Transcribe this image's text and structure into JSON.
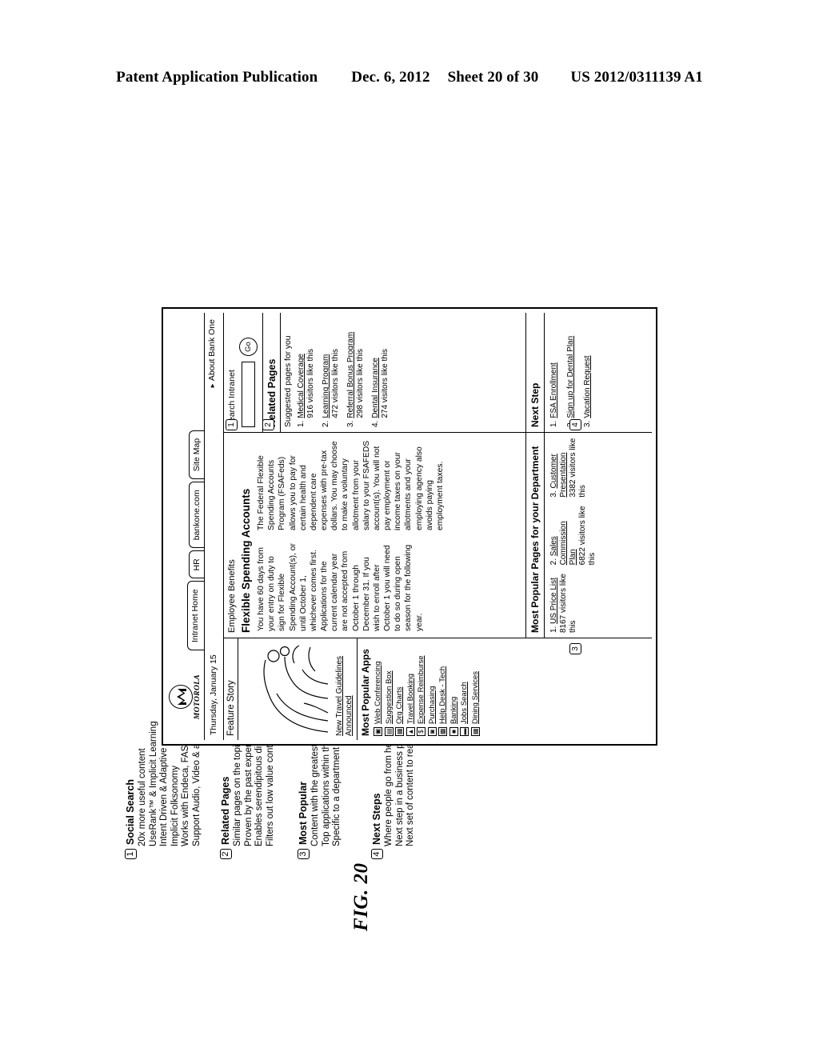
{
  "patent_header": {
    "publication": "Patent Application Publication",
    "date": "Dec. 6, 2012",
    "sheet": "Sheet 20 of 30",
    "number": "US 2012/0311139 A1"
  },
  "figure": {
    "caption": "FIG. 20"
  },
  "callouts": [
    {
      "num": "1",
      "title": "Social Search",
      "bullets": [
        "20x more useful content",
        "UseRank™ & Implicit Learning",
        "Intent Driven & Adaptive",
        "Implicit Folksonomy",
        "Works with Endeca, FAST, any engine",
        "Support Audio, Video & all Content Types"
      ]
    },
    {
      "num": "2",
      "title": "Related Pages",
      "bullets": [
        "Similar pages on the topic",
        "Proven by the past experience of peers",
        "Enables serendipitous discovery",
        "Filters out low value content"
      ]
    },
    {
      "num": "3",
      "title": "Most Popular",
      "bullets": [
        "Content with the greatest value",
        "Top applications within the company",
        "Specific to a department or cross company"
      ]
    },
    {
      "num": "4",
      "title": "Next Steps",
      "bullets": [
        "Where people go from here to meet goals",
        "Next step in a business process",
        "Next set of content to read"
      ]
    }
  ],
  "browser": {
    "logo_word": "MOTOROLA",
    "tabs": [
      {
        "label": "Intranet Home",
        "active": true
      },
      {
        "label": "HR",
        "active": false
      },
      {
        "label": "bankone.com",
        "active": false
      },
      {
        "label": "Site Map",
        "active": false
      }
    ],
    "date": "Thursday, January 15",
    "about_link": "About Bank One",
    "left_column": {
      "feature_story_title": "Feature Story",
      "travel_link": "New Travel Guidelines Announced",
      "apps_heading": "Most Popular Apps",
      "apps": [
        {
          "label": "Web Conferencing",
          "icon": "webcam-icon"
        },
        {
          "label": "Suggestion Box",
          "icon": "inbox-icon"
        },
        {
          "label": "Org Charts",
          "icon": "org-chart-icon"
        },
        {
          "label": "Travel Booking",
          "icon": "plane-icon"
        },
        {
          "label": "Expense Reimburse",
          "icon": "dollar-icon"
        },
        {
          "label": "Purchasing",
          "icon": "cart-icon"
        },
        {
          "label": "Help Desk - Tech",
          "icon": "wrench-icon"
        },
        {
          "label": "Banking",
          "icon": "bank-icon"
        },
        {
          "label": "Jobs Search",
          "icon": "briefcase-icon"
        },
        {
          "label": "Dining Services",
          "icon": "cutlery-icon"
        }
      ]
    },
    "center_column": {
      "breadcrumb": "Employee Benefits",
      "page_title": "Flexible Spending Accounts",
      "paragraph_1": "You have 60 days from your entry on duty to sign for Flexible Spending Account(s), or until October 1, whichever comes first. Applications for the current calendar year are not accepted from October 1 through December 31. If you wish to enroll after October 1 you will need to do so during open season for the following year.",
      "paragraph_2": "The Federal Flexible Spending Accounts Program (FSAFeds) allows you to pay for certain health and dependent care expenses with pre-tax dollars. You may choose to make a voluntary allotment from your salary to your FSAFEDS account(s). You will not pay employment or income taxes on your allotments and your employing agency also avoids paying employment taxes.",
      "most_popular_heading": "Most Popular Pages for your Department",
      "most_popular": [
        {
          "rank": "1.",
          "title": "US Price List",
          "visitors": "8167 visitors like this"
        },
        {
          "rank": "2.",
          "title": "Sales Commission Plan",
          "visitors": "6822 visitors like this"
        },
        {
          "rank": "3.",
          "title": "Customer Presentation",
          "visitors": "3382 visitors like this"
        }
      ]
    },
    "right_column": {
      "search_label": "Search Intranet",
      "search_value": "",
      "go_label": "Go",
      "related_heading": "Related Pages",
      "related_sub": "Suggested pages for you",
      "related": [
        {
          "rank": "1.",
          "title": "Medical Coverage",
          "visitors": "916 visitors like this"
        },
        {
          "rank": "2.",
          "title": "Learning Program",
          "visitors": "472 visitors like this"
        },
        {
          "rank": "3.",
          "title": "Referral Bonus Program",
          "visitors": "298 visitors like this"
        },
        {
          "rank": "4.",
          "title": "Dental Insurance",
          "visitors": "274 visitors like this"
        }
      ],
      "next_step_heading": "Next Step",
      "next_steps": [
        {
          "rank": "1.",
          "title": "FSA Enrollment"
        },
        {
          "rank": "2.",
          "title": "Sign up for Dental Plan"
        },
        {
          "rank": "3.",
          "title": "Vacation Request"
        }
      ]
    },
    "badges": [
      "1",
      "2",
      "3",
      "4"
    ]
  }
}
